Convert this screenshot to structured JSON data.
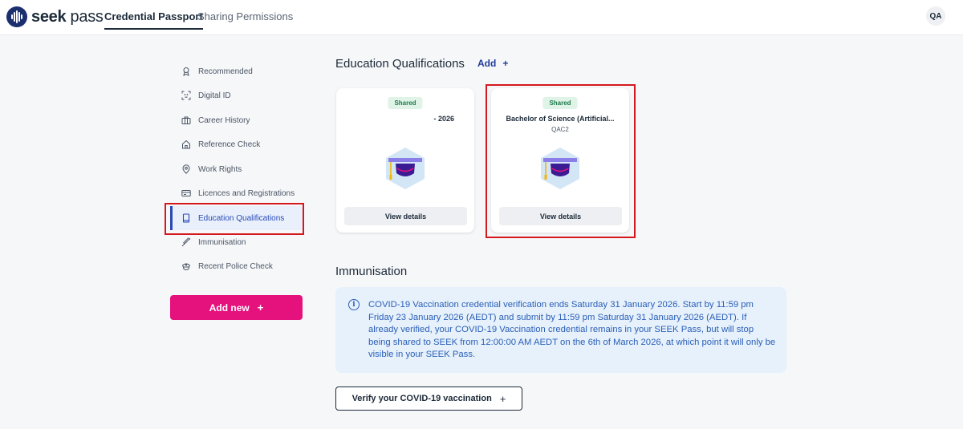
{
  "header": {
    "logo_bold": "seek",
    "logo_light": " pass",
    "tabs": [
      {
        "label": "Credential Passport",
        "active": true
      },
      {
        "label": "Sharing Permissions",
        "active": false
      }
    ],
    "avatar_initials": "QA"
  },
  "sidebar": {
    "items": [
      {
        "label": "Recommended",
        "icon": "ribbon-icon"
      },
      {
        "label": "Digital ID",
        "icon": "face-scan-icon"
      },
      {
        "label": "Career History",
        "icon": "briefcase-icon"
      },
      {
        "label": "Reference Check",
        "icon": "house-icon"
      },
      {
        "label": "Work Rights",
        "icon": "location-pin-icon"
      },
      {
        "label": "Licences and Registrations",
        "icon": "id-card-icon"
      },
      {
        "label": "Education Qualifications",
        "icon": "book-icon",
        "active": true
      },
      {
        "label": "Immunisation",
        "icon": "syringe-icon"
      },
      {
        "label": "Recent Police Check",
        "icon": "police-hat-icon"
      }
    ],
    "add_new_label": "Add new",
    "add_new_plus": "+"
  },
  "education": {
    "title": "Education Qualifications",
    "add_label": "Add",
    "add_plus": "+",
    "cards": [
      {
        "badge": "Shared",
        "title": "- 2026",
        "subtitle": "",
        "button": "View details"
      },
      {
        "badge": "Shared",
        "title": "Bachelor of Science (Artificial...",
        "subtitle": "QAC2",
        "button": "View details"
      }
    ]
  },
  "immunisation": {
    "title": "Immunisation",
    "info_icon": "i",
    "notice": "COVID-19 Vaccination credential verification ends Saturday 31 January 2026. Start by 11:59 pm Friday 23 January 2026 (AEDT) and submit by 11:59 pm Saturday 31 January 2026 (AEDT). If already verified, your COVID-19 Vaccination credential remains in your SEEK Pass, but will stop being shared to SEEK from 12:00:00 AM AEDT on the 6th of March 2026, at which point it will only be visible in your SEEK Pass.",
    "verify_label": "Verify your COVID-19 vaccination",
    "verify_plus": "+"
  },
  "colors": {
    "brand_navy": "#1b2f6e",
    "accent_pink": "#e5117d",
    "active_blue": "#2749b8",
    "shared_green": "#1e7a4c",
    "highlight_red": "#d4181d"
  }
}
